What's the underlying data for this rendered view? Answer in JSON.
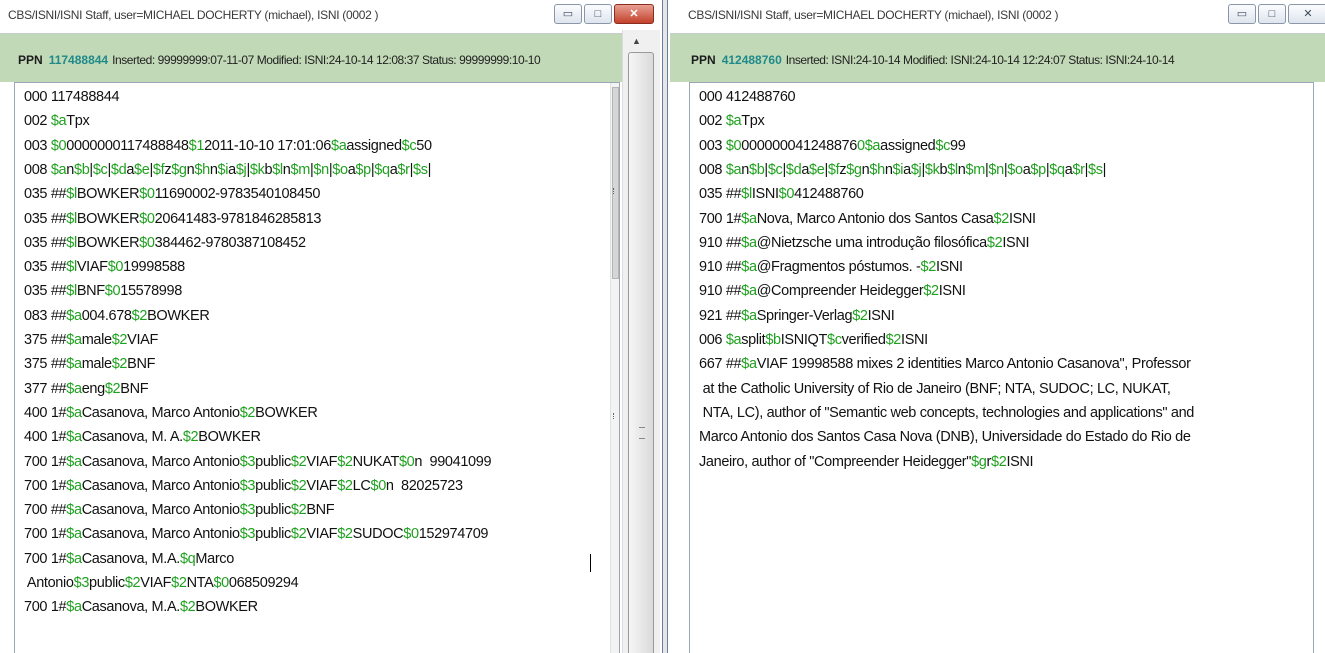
{
  "left_window": {
    "title": "CBS/ISNI/ISNI Staff, user=MICHAEL DOCHERTY (michael), ISNI (0002 )",
    "ppn_label": "PPN",
    "ppn_number": "117488844",
    "ppn_info": "Inserted: 99999999:07-11-07 Modified: ISNI:24-10-14 12:08:37 Status: 99999999:10-10",
    "lines": [
      [
        [
          "000 117488844",
          "t"
        ]
      ],
      [
        [
          "002 ",
          "t"
        ],
        [
          "$a",
          "d"
        ],
        [
          "Tpx",
          "t"
        ]
      ],
      [
        [
          "003 ",
          "t"
        ],
        [
          "$0",
          "d"
        ],
        [
          "0000000117488848",
          "t"
        ],
        [
          "$1",
          "d"
        ],
        [
          "2011-10-10 17:01:06",
          "t"
        ],
        [
          "$a",
          "d"
        ],
        [
          "assigned",
          "t"
        ],
        [
          "$c",
          "d"
        ],
        [
          "50",
          "t"
        ]
      ],
      [
        [
          "008 ",
          "t"
        ],
        [
          "$a",
          "d"
        ],
        [
          "n",
          "t"
        ],
        [
          "$b",
          "d"
        ],
        [
          "|",
          "t"
        ],
        [
          "$c",
          "d"
        ],
        [
          "|",
          "t"
        ],
        [
          "$d",
          "d"
        ],
        [
          "a",
          "t"
        ],
        [
          "$e",
          "d"
        ],
        [
          "|",
          "t"
        ],
        [
          "$f",
          "d"
        ],
        [
          "z",
          "t"
        ],
        [
          "$g",
          "d"
        ],
        [
          "n",
          "t"
        ],
        [
          "$h",
          "d"
        ],
        [
          "n",
          "t"
        ],
        [
          "$i",
          "d"
        ],
        [
          "a",
          "t"
        ],
        [
          "$j",
          "d"
        ],
        [
          "|",
          "t"
        ],
        [
          "$k",
          "d"
        ],
        [
          "b",
          "t"
        ],
        [
          "$l",
          "d"
        ],
        [
          "n",
          "t"
        ],
        [
          "$m",
          "d"
        ],
        [
          "|",
          "t"
        ],
        [
          "$n",
          "d"
        ],
        [
          "|",
          "t"
        ],
        [
          "$o",
          "d"
        ],
        [
          "a",
          "t"
        ],
        [
          "$p",
          "d"
        ],
        [
          "|",
          "t"
        ],
        [
          "$q",
          "d"
        ],
        [
          "a",
          "t"
        ],
        [
          "$r",
          "d"
        ],
        [
          "|",
          "t"
        ],
        [
          "$s",
          "d"
        ],
        [
          "|",
          "t"
        ]
      ],
      [
        [
          "035 ##",
          "t"
        ],
        [
          "$l",
          "d"
        ],
        [
          "BOWKER",
          "t"
        ],
        [
          "$0",
          "d"
        ],
        [
          "11690002-9783540108450",
          "t"
        ]
      ],
      [
        [
          "035 ##",
          "t"
        ],
        [
          "$l",
          "d"
        ],
        [
          "BOWKER",
          "t"
        ],
        [
          "$0",
          "d"
        ],
        [
          "20641483-9781846285813",
          "t"
        ]
      ],
      [
        [
          "035 ##",
          "t"
        ],
        [
          "$l",
          "d"
        ],
        [
          "BOWKER",
          "t"
        ],
        [
          "$0",
          "d"
        ],
        [
          "384462-9780387108452",
          "t"
        ]
      ],
      [
        [
          "035 ##",
          "t"
        ],
        [
          "$l",
          "d"
        ],
        [
          "VIAF",
          "t"
        ],
        [
          "$0",
          "d"
        ],
        [
          "19998588",
          "t"
        ]
      ],
      [
        [
          "035 ##",
          "t"
        ],
        [
          "$l",
          "d"
        ],
        [
          "BNF",
          "t"
        ],
        [
          "$0",
          "d"
        ],
        [
          "15578998",
          "t"
        ]
      ],
      [
        [
          "083 ##",
          "t"
        ],
        [
          "$a",
          "d"
        ],
        [
          "004.678",
          "t"
        ],
        [
          "$2",
          "d"
        ],
        [
          "BOWKER",
          "t"
        ]
      ],
      [
        [
          "375 ##",
          "t"
        ],
        [
          "$a",
          "d"
        ],
        [
          "male",
          "t"
        ],
        [
          "$2",
          "d"
        ],
        [
          "VIAF",
          "t"
        ]
      ],
      [
        [
          "375 ##",
          "t"
        ],
        [
          "$a",
          "d"
        ],
        [
          "male",
          "t"
        ],
        [
          "$2",
          "d"
        ],
        [
          "BNF",
          "t"
        ]
      ],
      [
        [
          "377 ##",
          "t"
        ],
        [
          "$a",
          "d"
        ],
        [
          "eng",
          "t"
        ],
        [
          "$2",
          "d"
        ],
        [
          "BNF",
          "t"
        ]
      ],
      [
        [
          "400 1#",
          "t"
        ],
        [
          "$a",
          "d"
        ],
        [
          "Casanova, Marco Antonio",
          "t"
        ],
        [
          "$2",
          "d"
        ],
        [
          "BOWKER",
          "t"
        ]
      ],
      [
        [
          "400 1#",
          "t"
        ],
        [
          "$a",
          "d"
        ],
        [
          "Casanova, M. A.",
          "t"
        ],
        [
          "$2",
          "d"
        ],
        [
          "BOWKER",
          "t"
        ]
      ],
      [
        [
          "700 1#",
          "t"
        ],
        [
          "$a",
          "d"
        ],
        [
          "Casanova, Marco Antonio",
          "t"
        ],
        [
          "$3",
          "d"
        ],
        [
          "public",
          "t"
        ],
        [
          "$2",
          "d"
        ],
        [
          "VIAF",
          "t"
        ],
        [
          "$2",
          "d"
        ],
        [
          "NUKAT",
          "t"
        ],
        [
          "$0",
          "d"
        ],
        [
          "n  99041099",
          "t"
        ]
      ],
      [
        [
          "700 1#",
          "t"
        ],
        [
          "$a",
          "d"
        ],
        [
          "Casanova, Marco Antonio",
          "t"
        ],
        [
          "$3",
          "d"
        ],
        [
          "public",
          "t"
        ],
        [
          "$2",
          "d"
        ],
        [
          "VIAF",
          "t"
        ],
        [
          "$2",
          "d"
        ],
        [
          "LC",
          "t"
        ],
        [
          "$0",
          "d"
        ],
        [
          "n  82025723",
          "t"
        ]
      ],
      [
        [
          "700 ##",
          "t"
        ],
        [
          "$a",
          "d"
        ],
        [
          "Casanova, Marco Antonio",
          "t"
        ],
        [
          "$3",
          "d"
        ],
        [
          "public",
          "t"
        ],
        [
          "$2",
          "d"
        ],
        [
          "BNF",
          "t"
        ]
      ],
      [
        [
          "700 1#",
          "t"
        ],
        [
          "$a",
          "d"
        ],
        [
          "Casanova, Marco Antonio",
          "t"
        ],
        [
          "$3",
          "d"
        ],
        [
          "public",
          "t"
        ],
        [
          "$2",
          "d"
        ],
        [
          "VIAF",
          "t"
        ],
        [
          "$2",
          "d"
        ],
        [
          "SUDOC",
          "t"
        ],
        [
          "$0",
          "d"
        ],
        [
          "152974709",
          "t"
        ]
      ],
      [
        [
          "700 1#",
          "t"
        ],
        [
          "$a",
          "d"
        ],
        [
          "Casanova, M.A.",
          "t"
        ],
        [
          "$q",
          "d"
        ],
        [
          "Marco",
          "t"
        ]
      ],
      [
        [
          " Antonio",
          "t"
        ],
        [
          "$3",
          "d"
        ],
        [
          "public",
          "t"
        ],
        [
          "$2",
          "d"
        ],
        [
          "VIAF",
          "t"
        ],
        [
          "$2",
          "d"
        ],
        [
          "NTA",
          "t"
        ],
        [
          "$0",
          "d"
        ],
        [
          "068509294",
          "t"
        ]
      ],
      [
        [
          "700 1#",
          "t"
        ],
        [
          "$a",
          "d"
        ],
        [
          "Casanova, M.A.",
          "t"
        ],
        [
          "$2",
          "d"
        ],
        [
          "BOWKER",
          "t"
        ]
      ]
    ]
  },
  "right_window": {
    "title": "CBS/ISNI/ISNI Staff, user=MICHAEL DOCHERTY (michael), ISNI (0002 )",
    "ppn_label": "PPN",
    "ppn_number": "412488760",
    "ppn_info": "Inserted: ISNI:24-10-14 Modified: ISNI:24-10-14 12:24:07 Status: ISNI:24-10-14",
    "lines": [
      [
        [
          "000 412488760",
          "t"
        ]
      ],
      [
        [
          "002 ",
          "t"
        ],
        [
          "$a",
          "d"
        ],
        [
          "Tpx",
          "t"
        ]
      ],
      [
        [
          "003 ",
          "t"
        ],
        [
          "$0",
          "d"
        ],
        [
          "000000041248876",
          "t"
        ],
        [
          "0$a",
          "d"
        ],
        [
          "assigned",
          "t"
        ],
        [
          "$c",
          "d"
        ],
        [
          "99",
          "t"
        ]
      ],
      [
        [
          "008 ",
          "t"
        ],
        [
          "$a",
          "d"
        ],
        [
          "n",
          "t"
        ],
        [
          "$b",
          "d"
        ],
        [
          "|",
          "t"
        ],
        [
          "$c",
          "d"
        ],
        [
          "|",
          "t"
        ],
        [
          "$d",
          "d"
        ],
        [
          "a",
          "t"
        ],
        [
          "$e",
          "d"
        ],
        [
          "|",
          "t"
        ],
        [
          "$f",
          "d"
        ],
        [
          "z",
          "t"
        ],
        [
          "$g",
          "d"
        ],
        [
          "n",
          "t"
        ],
        [
          "$h",
          "d"
        ],
        [
          "n",
          "t"
        ],
        [
          "$i",
          "d"
        ],
        [
          "a",
          "t"
        ],
        [
          "$j",
          "d"
        ],
        [
          "|",
          "t"
        ],
        [
          "$k",
          "d"
        ],
        [
          "b",
          "t"
        ],
        [
          "$l",
          "d"
        ],
        [
          "n",
          "t"
        ],
        [
          "$m",
          "d"
        ],
        [
          "|",
          "t"
        ],
        [
          "$n",
          "d"
        ],
        [
          "|",
          "t"
        ],
        [
          "$o",
          "d"
        ],
        [
          "a",
          "t"
        ],
        [
          "$p",
          "d"
        ],
        [
          "|",
          "t"
        ],
        [
          "$q",
          "d"
        ],
        [
          "a",
          "t"
        ],
        [
          "$r",
          "d"
        ],
        [
          "|",
          "t"
        ],
        [
          "$s",
          "d"
        ],
        [
          "|",
          "t"
        ]
      ],
      [
        [
          "035 ##",
          "t"
        ],
        [
          "$l",
          "d"
        ],
        [
          "ISNI",
          "t"
        ],
        [
          "$0",
          "d"
        ],
        [
          "412488760",
          "t"
        ]
      ],
      [
        [
          "700 1#",
          "t"
        ],
        [
          "$a",
          "d"
        ],
        [
          "Nova, Marco Antonio dos Santos Casa",
          "t"
        ],
        [
          "$2",
          "d"
        ],
        [
          "ISNI",
          "t"
        ]
      ],
      [
        [
          "910 ##",
          "t"
        ],
        [
          "$a",
          "d"
        ],
        [
          "@Nietzsche uma introdução filosófica",
          "t"
        ],
        [
          "$2",
          "d"
        ],
        [
          "ISNI",
          "t"
        ]
      ],
      [
        [
          "910 ##",
          "t"
        ],
        [
          "$a",
          "d"
        ],
        [
          "@Fragmentos póstumos. -",
          "t"
        ],
        [
          "$2",
          "d"
        ],
        [
          "ISNI",
          "t"
        ]
      ],
      [
        [
          "910 ##",
          "t"
        ],
        [
          "$a",
          "d"
        ],
        [
          "@Compreender Heidegger",
          "t"
        ],
        [
          "$2",
          "d"
        ],
        [
          "ISNI",
          "t"
        ]
      ],
      [
        [
          "921 ##",
          "t"
        ],
        [
          "$a",
          "d"
        ],
        [
          "Springer-Verlag",
          "t"
        ],
        [
          "$2",
          "d"
        ],
        [
          "ISNI",
          "t"
        ]
      ],
      [
        [
          "006 ",
          "t"
        ],
        [
          "$a",
          "d"
        ],
        [
          "split",
          "t"
        ],
        [
          "$b",
          "d"
        ],
        [
          "ISNIQT",
          "t"
        ],
        [
          "$c",
          "d"
        ],
        [
          "verified",
          "t"
        ],
        [
          "$2",
          "d"
        ],
        [
          "ISNI",
          "t"
        ]
      ],
      [
        [
          "667 ##",
          "t"
        ],
        [
          "$a",
          "d"
        ],
        [
          "VIAF 19998588 mixes 2 identities Marco Antonio Casanova\", Professor",
          "t"
        ]
      ],
      [
        [
          " at the Catholic University of Rio de Janeiro (BNF; NTA, SUDOC; LC, NUKAT,",
          "t"
        ]
      ],
      [
        [
          " NTA, LC), author of \"Semantic web concepts, technologies and applications\" and",
          "t"
        ]
      ],
      [
        [
          "Marco Antonio dos Santos Casa Nova (DNB), Universidade do Estado do Rio de",
          "t"
        ]
      ],
      [
        [
          "Janeiro, author of \"Compreender Heidegger\"",
          "t"
        ],
        [
          "$g",
          "d"
        ],
        [
          "r",
          "t"
        ],
        [
          "$2",
          "d"
        ],
        [
          "ISNI",
          "t"
        ]
      ]
    ]
  },
  "window_buttons": {
    "minimize": "▭",
    "maximize": "□",
    "close": "✕"
  },
  "colors": {
    "subfield_code": "#1fa11f",
    "header_bg": "#c2d9b7",
    "ppn_number": "#1f8a8a"
  }
}
